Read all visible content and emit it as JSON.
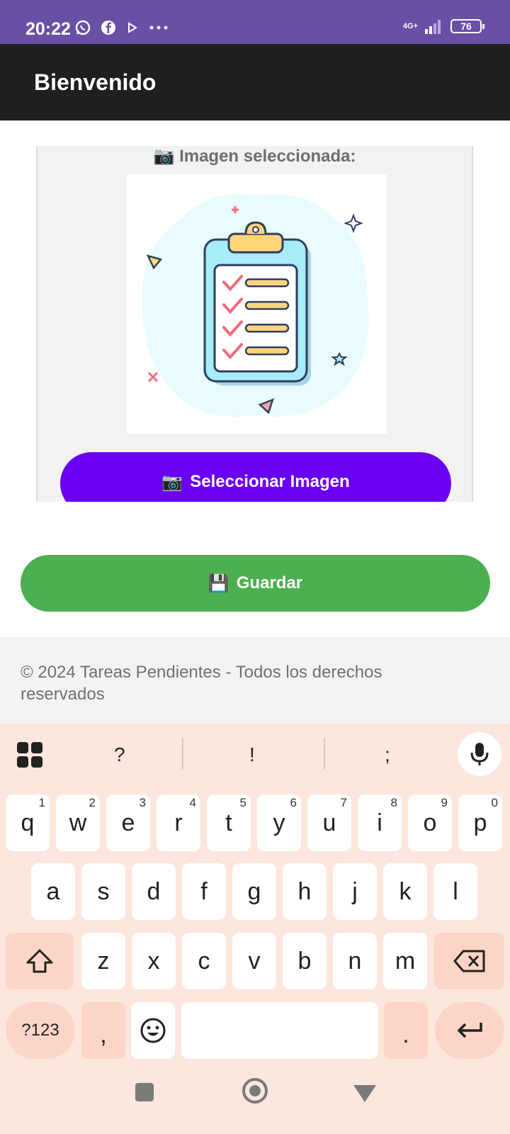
{
  "status_bar": {
    "time": "20:22",
    "network": "4G+",
    "battery": "76"
  },
  "app_bar": {
    "title": "Bienvenido"
  },
  "card": {
    "label_icon": "📷",
    "label": "Imagen seleccionada:",
    "select_button_icon": "📷",
    "select_button": "Seleccionar Imagen"
  },
  "save": {
    "icon": "💾",
    "label": "Guardar"
  },
  "footer": {
    "text": "© 2024 Tareas Pendientes - Todos los derechos reservados"
  },
  "keyboard": {
    "suggestions": [
      "?",
      "!",
      ";"
    ],
    "row1": [
      {
        "k": "q",
        "h": "1"
      },
      {
        "k": "w",
        "h": "2"
      },
      {
        "k": "e",
        "h": "3"
      },
      {
        "k": "r",
        "h": "4"
      },
      {
        "k": "t",
        "h": "5"
      },
      {
        "k": "y",
        "h": "6"
      },
      {
        "k": "u",
        "h": "7"
      },
      {
        "k": "i",
        "h": "8"
      },
      {
        "k": "o",
        "h": "9"
      },
      {
        "k": "p",
        "h": "0"
      }
    ],
    "row2": [
      "a",
      "s",
      "d",
      "f",
      "g",
      "h",
      "j",
      "k",
      "l"
    ],
    "row3": [
      "z",
      "x",
      "c",
      "v",
      "b",
      "n",
      "m"
    ],
    "symbols_key": "?123",
    "comma_key": ",",
    "period_key": "."
  }
}
